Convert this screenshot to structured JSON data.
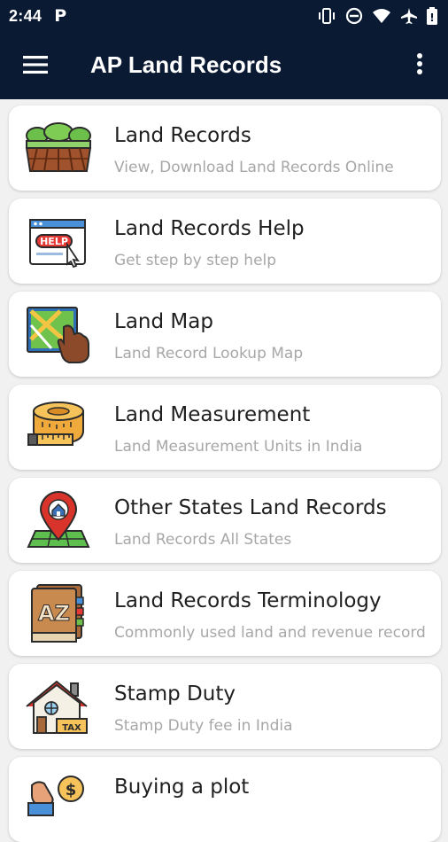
{
  "status": {
    "time": "2:44",
    "notification_icon": "parking-icon"
  },
  "appbar": {
    "title": "AP Land Records"
  },
  "items": [
    {
      "title": "Land Records",
      "subtitle": "View, Download Land Records Online",
      "icon": "farm-field-icon"
    },
    {
      "title": "Land Records Help",
      "subtitle": "Get step by step help",
      "icon": "help-screen-icon"
    },
    {
      "title": "Land Map",
      "subtitle": "Land Record Lookup Map",
      "icon": "map-touch-icon"
    },
    {
      "title": "Land Measurement",
      "subtitle": "Land Measurement Units in India",
      "icon": "measuring-tape-icon"
    },
    {
      "title": "Other States Land Records",
      "subtitle": "Land Records All States",
      "icon": "location-pin-icon"
    },
    {
      "title": "Land Records Terminology",
      "subtitle": "Commonly used land and revenue record",
      "icon": "dictionary-icon"
    },
    {
      "title": "Stamp Duty",
      "subtitle": "Stamp Duty fee in India",
      "icon": "house-tax-icon"
    },
    {
      "title": "Buying a plot",
      "subtitle": "",
      "icon": "money-hand-icon"
    }
  ]
}
